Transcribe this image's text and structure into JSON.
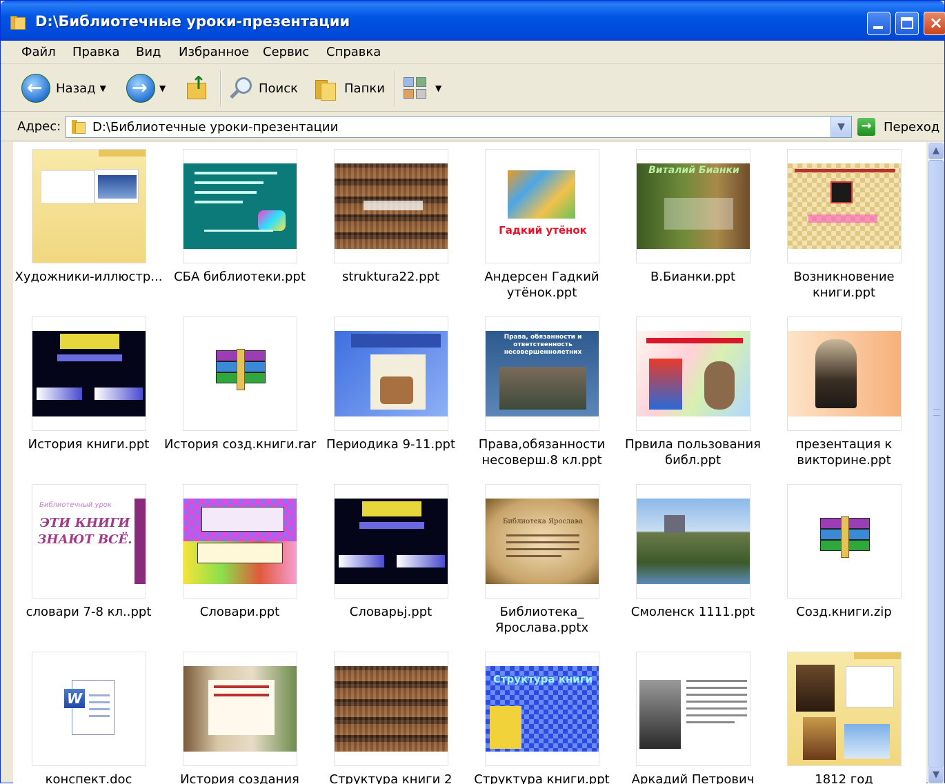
{
  "window": {
    "title": "D:\\Библиотечные уроки-презентации"
  },
  "menu": [
    "Файл",
    "Правка",
    "Вид",
    "Избранное",
    "Сервис",
    "Справка"
  ],
  "toolbar": {
    "back_label": "Назад",
    "search_label": "Поиск",
    "folders_label": "Папки"
  },
  "address": {
    "label": "Адрес:",
    "path": "D:\\Библиотечные уроки-презентации",
    "go_label": "Переход"
  },
  "files": [
    {
      "name": "Художники-иллюстр...",
      "kind": "folder"
    },
    {
      "name": "СБА библиотеки.ppt",
      "kind": "ppt"
    },
    {
      "name": "struktura22.ppt",
      "kind": "ppt"
    },
    {
      "name": "Андерсен Гадкий\nутёнок.ppt",
      "kind": "ppt"
    },
    {
      "name": "В.Бианки.ppt",
      "kind": "ppt"
    },
    {
      "name": "Возникновение\nкниги.ppt",
      "kind": "ppt"
    },
    {
      "name": "История книги.ppt",
      "kind": "ppt"
    },
    {
      "name": "История созд.книги.rar",
      "kind": "rar"
    },
    {
      "name": "Периодика 9-11.ppt",
      "kind": "ppt"
    },
    {
      "name": "Права,обязанности\nнесоверш.8 кл.ppt",
      "kind": "ppt"
    },
    {
      "name": "Првила пользования\nбибл.ppt",
      "kind": "ppt"
    },
    {
      "name": "презентация к\nвикторине.ppt",
      "kind": "ppt"
    },
    {
      "name": "словари 7-8 кл..ppt",
      "kind": "ppt"
    },
    {
      "name": "Словари.ppt",
      "kind": "ppt"
    },
    {
      "name": "Словарьj.ppt",
      "kind": "ppt"
    },
    {
      "name": "Библиотека_\nЯрослава.pptx",
      "kind": "pptx"
    },
    {
      "name": "Смоленск 1111.ppt",
      "kind": "ppt"
    },
    {
      "name": "Созд.книги.zip",
      "kind": "zip"
    },
    {
      "name": "конспект.doc",
      "kind": "doc"
    },
    {
      "name": "История создания",
      "kind": "ppt"
    },
    {
      "name": "Структура книги 2",
      "kind": "ppt"
    },
    {
      "name": "Структура книги.ppt",
      "kind": "ppt"
    },
    {
      "name": "Аркадий Петрович",
      "kind": "ppt"
    },
    {
      "name": "1812 год",
      "kind": "folder"
    }
  ],
  "thumb_text": {
    "ugly_duckling": "Гадкий утёнок",
    "dictionaries": "ЭТИ КНИГИ ЗНАЮТ ВСЁ.",
    "dict_header": "Библиотечный урок",
    "structure": "Структура книги",
    "rights": "Права, обязанности и ответственность несовершеннолетних",
    "bianki": "Виталий Бианки",
    "yaroslav": "Библиотека Ярослава"
  },
  "colors": {
    "title_bar": "#0054E3",
    "selection": "#316AC5"
  }
}
